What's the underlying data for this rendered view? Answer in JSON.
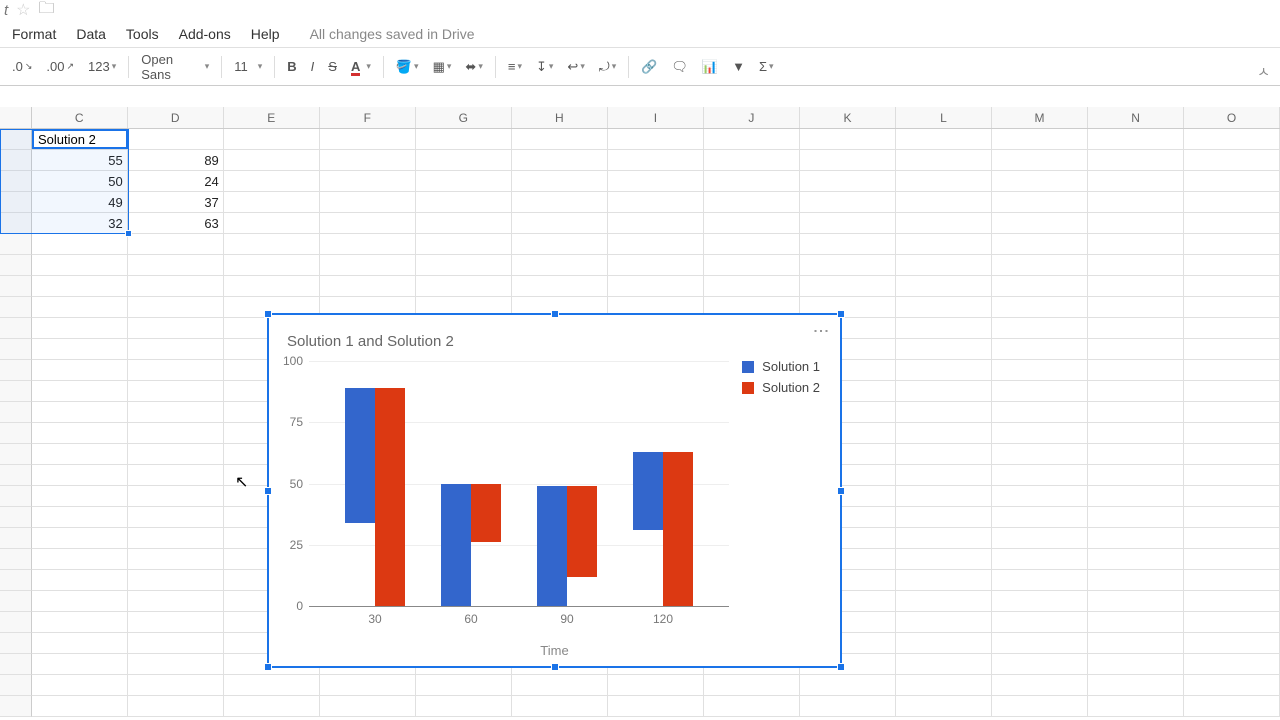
{
  "titlebar": {
    "doc_suffix": "t"
  },
  "menu": {
    "items": [
      "Format",
      "Data",
      "Tools",
      "Add-ons",
      "Help"
    ],
    "saved": "All changes saved in Drive"
  },
  "toolbar": {
    "dec0": ".0",
    "dec00": ".00",
    "fmt123": "123",
    "font": "Open Sans",
    "size": "11",
    "sigma": "Σ"
  },
  "columns": [
    "C",
    "D",
    "E",
    "F",
    "G",
    "H",
    "I",
    "J",
    "K",
    "L",
    "M",
    "N",
    "O"
  ],
  "col_widths": {
    "row_header": 32,
    "default": 97
  },
  "cells": {
    "header_D": "Solution 2",
    "c1": "55",
    "d1": "89",
    "c2": "50",
    "d2": "24",
    "c3": "49",
    "d3": "37",
    "c4": "32",
    "d4": "63"
  },
  "chart_data": {
    "type": "bar",
    "title": "Solution 1 and Solution 2",
    "xlabel": "Time",
    "ylabel": "",
    "categories": [
      "30",
      "60",
      "90",
      "120"
    ],
    "series": [
      {
        "name": "Solution 1",
        "color": "#3366cc",
        "values": [
          55,
          50,
          49,
          32
        ]
      },
      {
        "name": "Solution 2",
        "color": "#dc3912",
        "values": [
          89,
          24,
          37,
          63
        ]
      }
    ],
    "ylim": [
      0,
      100
    ],
    "yticks": [
      0,
      25,
      50,
      75,
      100
    ]
  }
}
